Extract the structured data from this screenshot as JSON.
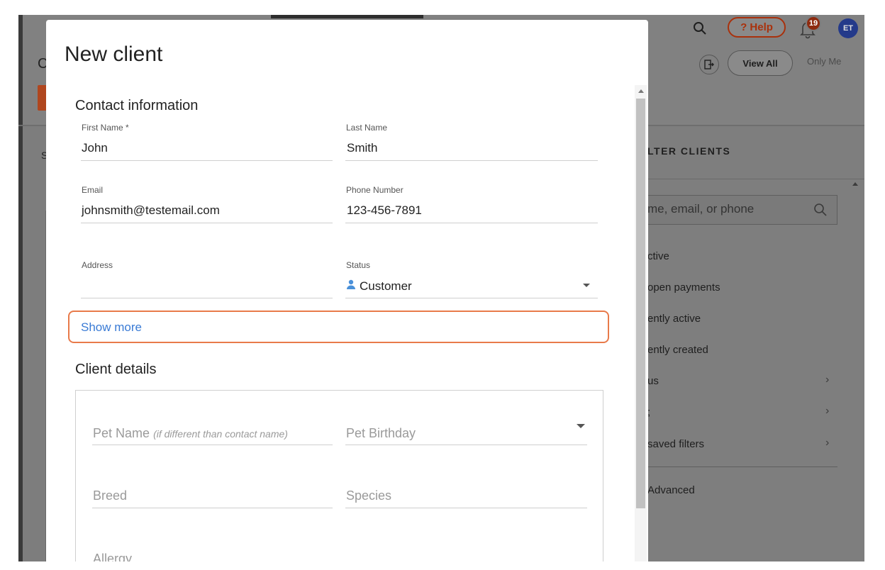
{
  "background": {
    "header": {
      "title_partial": "C",
      "sub_partial": "S",
      "help_label": "? Help",
      "notification_count": "19",
      "avatar_initials": "ET",
      "view_all": "View All",
      "only_me": "Only Me"
    },
    "filter_panel": {
      "title": "LTER CLIENTS",
      "search_placeholder": "me, email, or phone",
      "items": [
        {
          "label": "ctive",
          "chevron": false
        },
        {
          "label": "open payments",
          "chevron": false
        },
        {
          "label": "ently active",
          "chevron": false
        },
        {
          "label": "ently created",
          "chevron": false
        },
        {
          "label": "us",
          "chevron": true
        },
        {
          "label": ";",
          "chevron": true
        },
        {
          "label": "saved filters",
          "chevron": true
        }
      ],
      "advanced": "Advanced"
    }
  },
  "modal": {
    "title": "New client",
    "contact_section": "Contact information",
    "fields": {
      "first_name": {
        "label": "First Name *",
        "value": "John"
      },
      "last_name": {
        "label": "Last Name",
        "value": "Smith"
      },
      "email": {
        "label": "Email",
        "value": "johnsmith@testemail.com"
      },
      "phone": {
        "label": "Phone Number",
        "value": "123-456-7891"
      },
      "address": {
        "label": "Address",
        "value": ""
      },
      "status": {
        "label": "Status",
        "value": "Customer"
      }
    },
    "show_more": "Show more",
    "details_section": "Client details",
    "details": {
      "pet_name": "Pet Name",
      "pet_name_note": "(if different than contact name)",
      "pet_birthday": "Pet Birthday",
      "breed": "Breed",
      "species": "Species",
      "allergy": "Allergy"
    }
  },
  "colors": {
    "accent_orange": "#e87a4a",
    "link_blue": "#3a7bd5",
    "status_icon": "#4a90d9"
  }
}
